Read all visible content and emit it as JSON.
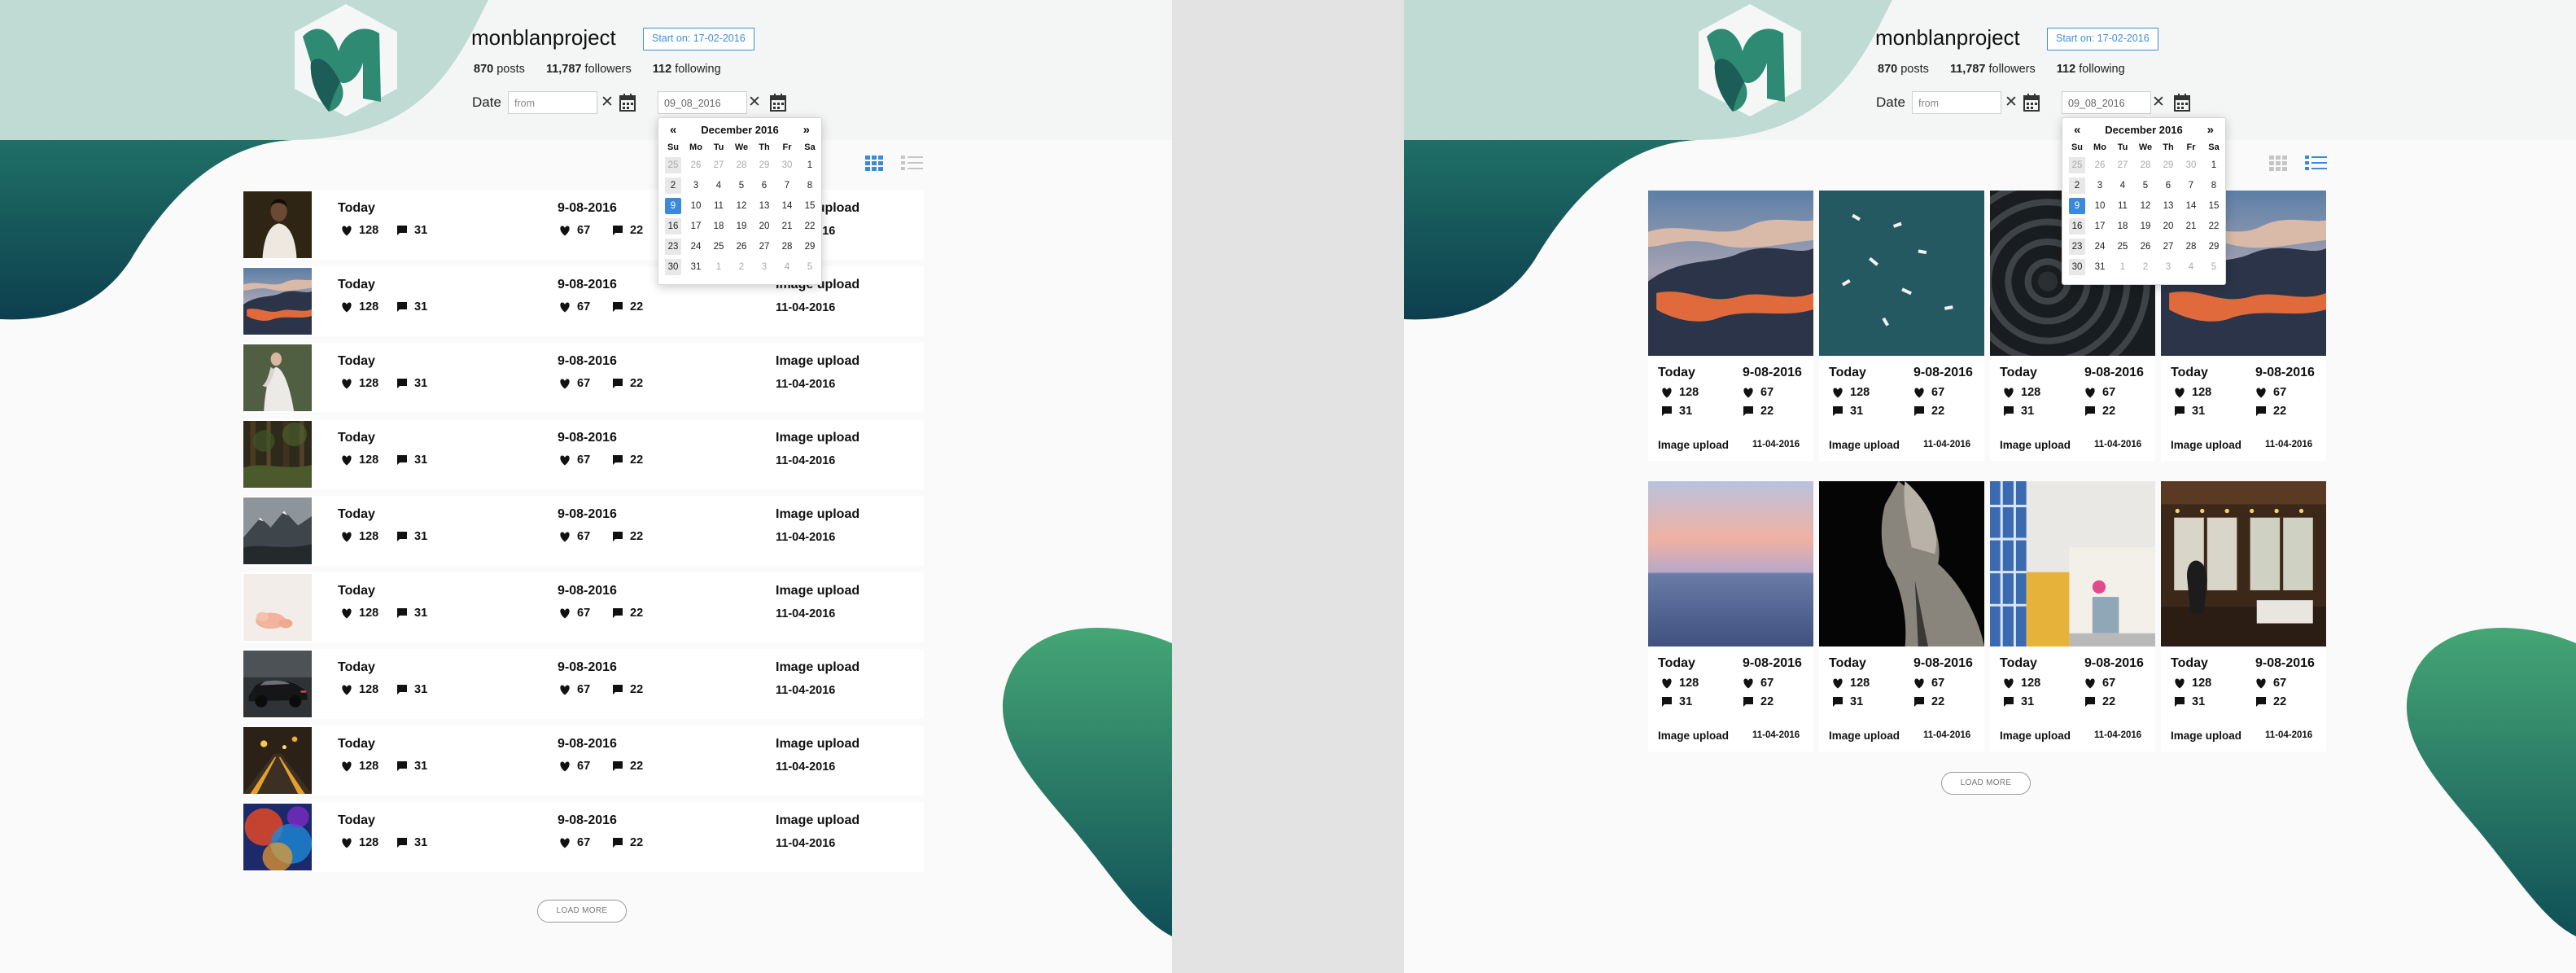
{
  "profile": {
    "username": "monblanproject",
    "start_label": "Start on: 17-02-2016",
    "posts_count": "870",
    "posts_label": "posts",
    "followers_count": "11,787",
    "followers_label": "followers",
    "following_count": "112",
    "following_label": "following"
  },
  "filter": {
    "date_label": "Date",
    "from_placeholder": "from",
    "to_value": "09_08_2016"
  },
  "datepicker": {
    "month_label": "December 2016",
    "prev": "«",
    "next": "»",
    "weekdays": [
      "Su",
      "Mo",
      "Tu",
      "We",
      "Th",
      "Fr",
      "Sa"
    ],
    "weeks": [
      [
        "25",
        "26",
        "27",
        "28",
        "29",
        "30",
        "1"
      ],
      [
        "2",
        "3",
        "4",
        "5",
        "6",
        "7",
        "8"
      ],
      [
        "9",
        "10",
        "11",
        "12",
        "13",
        "14",
        "15"
      ],
      [
        "16",
        "17",
        "18",
        "19",
        "20",
        "21",
        "22"
      ],
      [
        "23",
        "24",
        "25",
        "26",
        "27",
        "28",
        "29"
      ],
      [
        "30",
        "31",
        "1",
        "2",
        "3",
        "4",
        "5"
      ]
    ],
    "selected": "9"
  },
  "views": {
    "left_active": "grid",
    "right_active": "list",
    "accent_color": "#3b8ad9"
  },
  "list_rows": [
    {
      "thumb": "woman-portrait",
      "posted": "Today",
      "likes": "128",
      "comments": "31",
      "date": "9-08-2016",
      "likes2": "67",
      "comments2": "22",
      "type": "Image upload",
      "type_date": "11-04-2016"
    },
    {
      "thumb": "sunset-clouds",
      "posted": "Today",
      "likes": "128",
      "comments": "31",
      "date": "9-08-2016",
      "likes2": "67",
      "comments2": "22",
      "type": "Image upload",
      "type_date": "11-04-2016"
    },
    {
      "thumb": "bride-dress",
      "posted": "Today",
      "likes": "128",
      "comments": "31",
      "date": "9-08-2016",
      "likes2": "67",
      "comments2": "22",
      "type": "Image upload",
      "type_date": "11-04-2016"
    },
    {
      "thumb": "forest",
      "posted": "Today",
      "likes": "128",
      "comments": "31",
      "date": "9-08-2016",
      "likes2": "67",
      "comments2": "22",
      "type": "Image upload",
      "type_date": "11-04-2016"
    },
    {
      "thumb": "mountains",
      "posted": "Today",
      "likes": "128",
      "comments": "31",
      "date": "9-08-2016",
      "likes2": "67",
      "comments2": "22",
      "type": "Image upload",
      "type_date": "11-04-2016"
    },
    {
      "thumb": "peach-blur",
      "posted": "Today",
      "likes": "128",
      "comments": "31",
      "date": "9-08-2016",
      "likes2": "67",
      "comments2": "22",
      "type": "Image upload",
      "type_date": "11-04-2016"
    },
    {
      "thumb": "car",
      "posted": "Today",
      "likes": "128",
      "comments": "31",
      "date": "9-08-2016",
      "likes2": "67",
      "comments2": "22",
      "type": "Image upload",
      "type_date": "11-04-2016"
    },
    {
      "thumb": "street-night",
      "posted": "Today",
      "likes": "128",
      "comments": "31",
      "date": "9-08-2016",
      "likes2": "67",
      "comments2": "22",
      "type": "Image upload",
      "type_date": "11-04-2016"
    },
    {
      "thumb": "colorful-smoke",
      "posted": "Today",
      "likes": "128",
      "comments": "31",
      "date": "9-08-2016",
      "likes2": "67",
      "comments2": "22",
      "type": "Image upload",
      "type_date": "11-04-2016"
    }
  ],
  "grid_cards": [
    {
      "thumb": "sunset-clouds",
      "posted": "Today",
      "date": "9-08-2016",
      "likes": "128",
      "likes2": "67",
      "comments": "31",
      "comments2": "22",
      "type": "Image upload",
      "type_date": "11-04-2016"
    },
    {
      "thumb": "boats-aerial",
      "posted": "Today",
      "date": "9-08-2016",
      "likes": "128",
      "likes2": "67",
      "comments": "31",
      "comments2": "22",
      "type": "Image upload",
      "type_date": "11-04-2016"
    },
    {
      "thumb": "dark-spiral",
      "posted": "Today",
      "date": "9-08-2016",
      "likes": "128",
      "likes2": "67",
      "comments": "31",
      "comments2": "22",
      "type": "Image upload",
      "type_date": "11-04-2016"
    },
    {
      "thumb": "sunset-clouds",
      "posted": "Today",
      "date": "9-08-2016",
      "likes": "128",
      "likes2": "67",
      "comments": "31",
      "comments2": "22",
      "type": "Image upload",
      "type_date": "11-04-2016"
    },
    {
      "thumb": "pastel-sea",
      "posted": "Today",
      "date": "9-08-2016",
      "likes": "128",
      "likes2": "67",
      "comments": "31",
      "comments2": "22",
      "type": "Image upload",
      "type_date": "11-04-2016"
    },
    {
      "thumb": "dark-figure",
      "posted": "Today",
      "date": "9-08-2016",
      "likes": "128",
      "likes2": "67",
      "comments": "31",
      "comments2": "22",
      "type": "Image upload",
      "type_date": "11-04-2016"
    },
    {
      "thumb": "building",
      "posted": "Today",
      "date": "9-08-2016",
      "likes": "128",
      "likes2": "67",
      "comments": "31",
      "comments2": "22",
      "type": "Image upload",
      "type_date": "11-04-2016"
    },
    {
      "thumb": "cabin-interior",
      "posted": "Today",
      "date": "9-08-2016",
      "likes": "128",
      "likes2": "67",
      "comments": "31",
      "comments2": "22",
      "type": "Image upload",
      "type_date": "11-04-2016"
    }
  ],
  "load_more": "LOAD MORE"
}
